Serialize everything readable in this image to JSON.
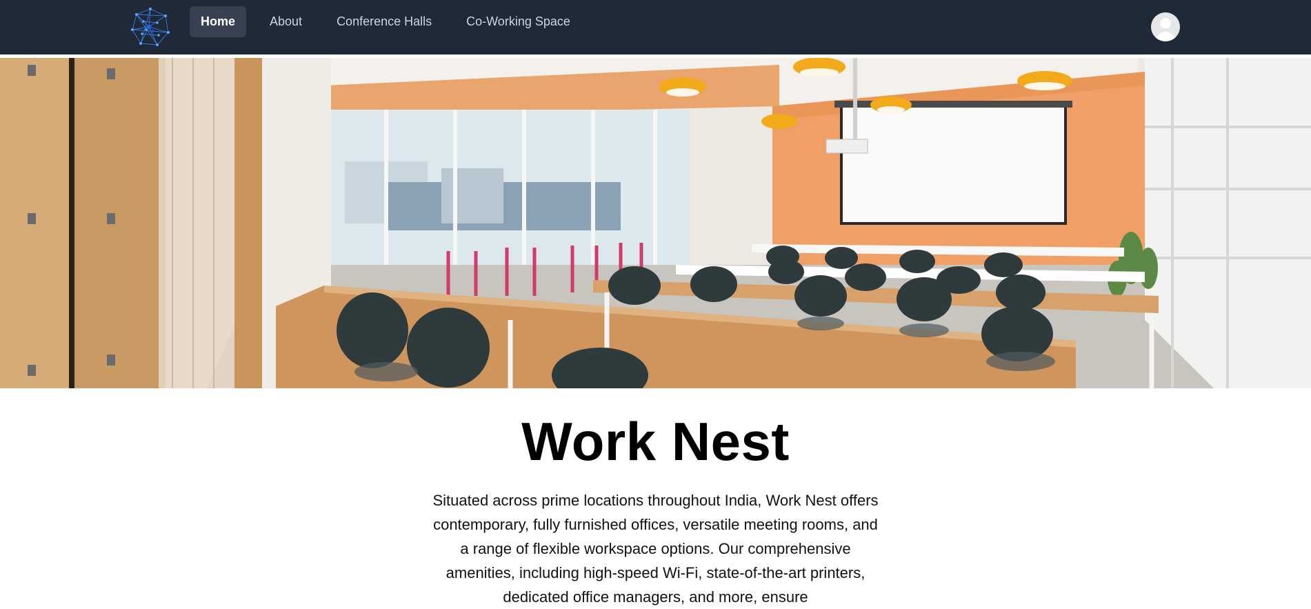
{
  "header": {
    "logo_icon": "network-constellation-icon",
    "nav": [
      {
        "label": "Home",
        "active": true
      },
      {
        "label": "About",
        "active": false
      },
      {
        "label": "Conference Halls",
        "active": false
      },
      {
        "label": "Co-Working Space",
        "active": false
      }
    ],
    "avatar_icon": "user-avatar-icon"
  },
  "hero": {
    "image": "conference-room-photo"
  },
  "main": {
    "title": "Work Nest",
    "description": "Situated across prime locations throughout India, Work Nest offers contemporary, fully furnished offices, versatile meeting rooms, and a range of flexible workspace options. Our comprehensive amenities, including high-speed Wi-Fi, state-of-the-art printers, dedicated office managers, and more, ensure"
  },
  "colors": {
    "navbar_bg": "#1f2937",
    "nav_active_bg": "#374151",
    "nav_text": "#d1d5db",
    "accent_wall": "#f0a066"
  }
}
